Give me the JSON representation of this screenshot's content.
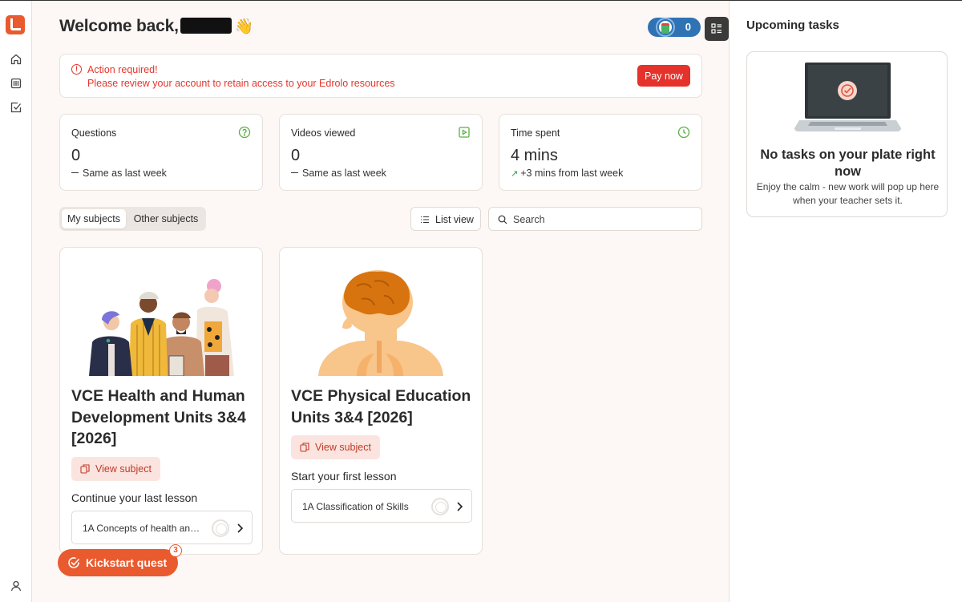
{
  "header": {
    "welcome": "Welcome back,",
    "wave": "👋",
    "streak_count": "0"
  },
  "alert": {
    "title": "Action required!",
    "message": "Please review your account to retain access to your Edrolo resources",
    "button": "Pay now"
  },
  "stats": [
    {
      "label": "Questions",
      "value": "0",
      "change": "Same as last week",
      "icon": "question-circle-icon"
    },
    {
      "label": "Videos viewed",
      "value": "0",
      "change": "Same as last week",
      "icon": "play-square-icon"
    },
    {
      "label": "Time spent",
      "value": "4 mins",
      "change": "+3 mins from last week",
      "icon": "clock-icon"
    }
  ],
  "filters": {
    "tabs": [
      "My subjects",
      "Other subjects"
    ],
    "active_tab": "My subjects",
    "list_view": "List view",
    "search_placeholder": "Search"
  },
  "subjects": [
    {
      "title": "VCE Health and Human Development Units 3&4 [2026]",
      "view_label": "View subject",
      "lesson_heading": "Continue your last lesson",
      "lesson": "1A Concepts of health and ..."
    },
    {
      "title": "VCE Physical Education Units 3&4 [2026]",
      "view_label": "View subject",
      "lesson_heading": "Start your first lesson",
      "lesson": "1A Classification of Skills"
    }
  ],
  "quest": {
    "label": "Kickstart quest",
    "badge": "3"
  },
  "tasks": {
    "title": "Upcoming tasks",
    "empty_title": "No tasks on your plate right now",
    "empty_text": "Enjoy the calm - new work will pop up here when your teacher sets it."
  },
  "colors": {
    "brand": "#ea5a2f",
    "alert": "#e4352c",
    "streak": "#2f73b5",
    "success": "#2f9a5a"
  }
}
